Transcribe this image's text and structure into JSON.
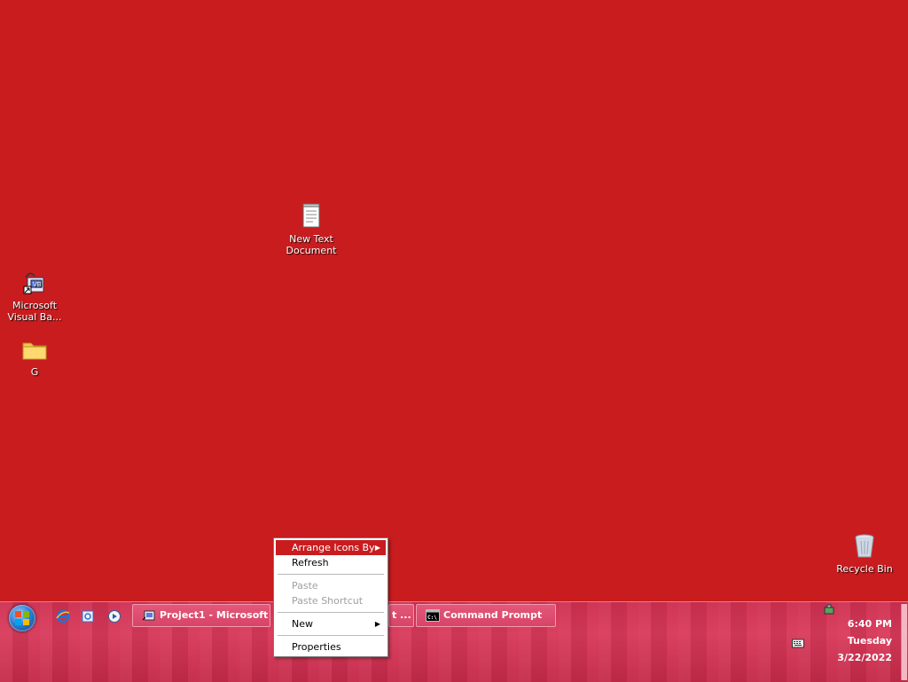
{
  "desktop": {
    "icons": [
      {
        "label_line1": "New Text",
        "label_line2": "Document",
        "icon": "text-document-icon"
      },
      {
        "label_line1": "Microsoft",
        "label_line2": "Visual Ba...",
        "icon": "visual-basic-icon"
      },
      {
        "label_line1": "G",
        "label_line2": "",
        "icon": "folder-icon"
      },
      {
        "label_line1": "Recycle Bin",
        "label_line2": "",
        "icon": "recycle-bin-icon"
      }
    ],
    "background_color": "#c91c1f"
  },
  "taskbar": {
    "start_icon": "windows-start-orb-icon",
    "quick_launch": [
      "internet-explorer-icon",
      "outlook-express-icon",
      "media-player-icon"
    ],
    "buttons": [
      {
        "label": "Project1 - Microsoft ...",
        "icon": "visual-basic-icon"
      },
      {
        "label": "t ...",
        "icon": ""
      },
      {
        "label": "Command Prompt",
        "icon": "command-prompt-icon"
      }
    ],
    "tray": {
      "time": "6:40 PM",
      "day": "Tuesday",
      "date": "3/22/2022",
      "icons": [
        "network-icon",
        "keyboard-icon"
      ]
    },
    "accent_color": "#d83a5a"
  },
  "context_menu": {
    "items": [
      {
        "label": "Arrange Icons By",
        "submenu": true,
        "selected": true,
        "disabled": false
      },
      {
        "label": "Refresh",
        "submenu": false,
        "selected": false,
        "disabled": false
      },
      {
        "label": "Paste",
        "submenu": false,
        "selected": false,
        "disabled": true
      },
      {
        "label": "Paste Shortcut",
        "submenu": false,
        "selected": false,
        "disabled": true
      },
      {
        "label": "New",
        "submenu": true,
        "selected": false,
        "disabled": false
      },
      {
        "label": "Properties",
        "submenu": false,
        "selected": false,
        "disabled": false
      }
    ],
    "highlight_color": "#c91c1f"
  }
}
